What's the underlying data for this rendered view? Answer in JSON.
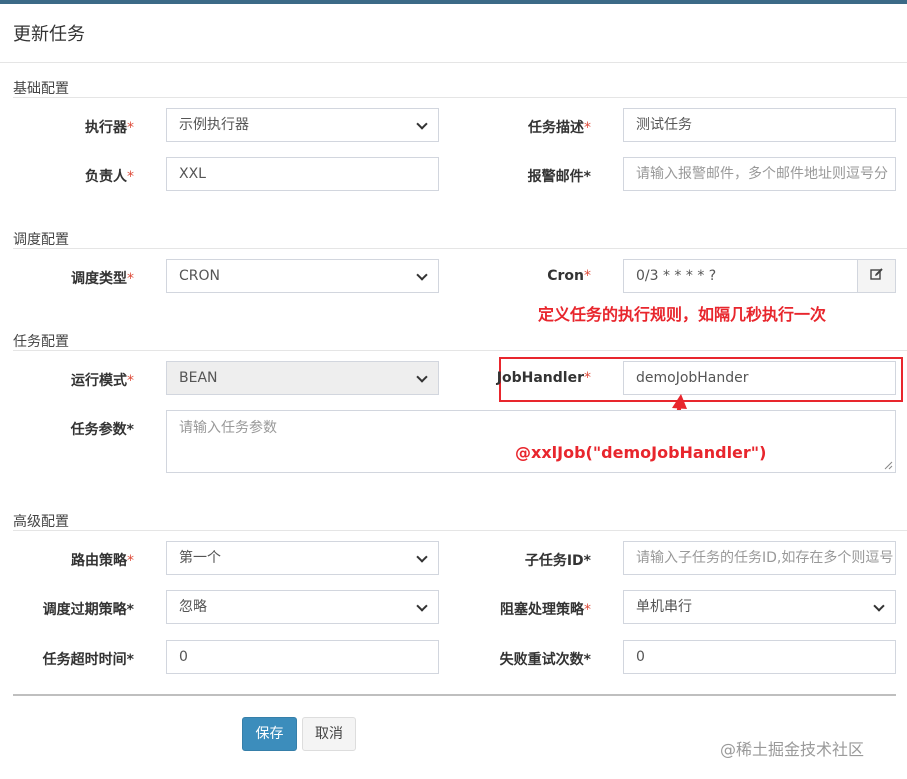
{
  "modal": {
    "title": "更新任务"
  },
  "sections": {
    "basic": "基础配置",
    "schedule": "调度配置",
    "task": "任务配置",
    "advanced": "高级配置"
  },
  "required_mark": "*",
  "fields": {
    "executor": {
      "label": "执行器",
      "value": "示例执行器"
    },
    "job_desc": {
      "label": "任务描述",
      "value": "测试任务"
    },
    "author": {
      "label": "负责人",
      "value": "XXL"
    },
    "alarm_email": {
      "label": "报警邮件",
      "placeholder": "请输入报警邮件，多个邮件地址则逗号分"
    },
    "schedule_type": {
      "label": "调度类型",
      "value": "CRON"
    },
    "cron": {
      "label": "Cron",
      "value": "0/3 * * * * ?"
    },
    "run_mode": {
      "label": "运行模式",
      "value": "BEAN"
    },
    "job_handler": {
      "label": "JobHandler",
      "value": "demoJobHander"
    },
    "job_param": {
      "label": "任务参数",
      "placeholder": "请输入任务参数"
    },
    "route_strategy": {
      "label": "路由策略",
      "value": "第一个"
    },
    "child_job_id": {
      "label": "子任务ID",
      "placeholder": "请输入子任务的任务ID,如存在多个则逗号"
    },
    "misfire_strategy": {
      "label": "调度过期策略",
      "value": "忽略"
    },
    "block_strategy": {
      "label": "阻塞处理策略",
      "value": "单机串行"
    },
    "timeout": {
      "label": "任务超时时间",
      "value": "0"
    },
    "fail_retry": {
      "label": "失败重试次数",
      "value": "0"
    }
  },
  "annotations": {
    "cron_note": "定义任务的执行规则，如隔几秒执行一次",
    "handler_note": "@xxlJob(\"demoJobHandler\")"
  },
  "buttons": {
    "save": "保存",
    "cancel": "取消"
  },
  "watermark": "@稀土掘金技术社区",
  "colors": {
    "primary": "#3c8dbc",
    "required": "#dd4b39",
    "annotation": "#e8262d"
  },
  "icons": {
    "cron_edit": "edit-icon"
  }
}
